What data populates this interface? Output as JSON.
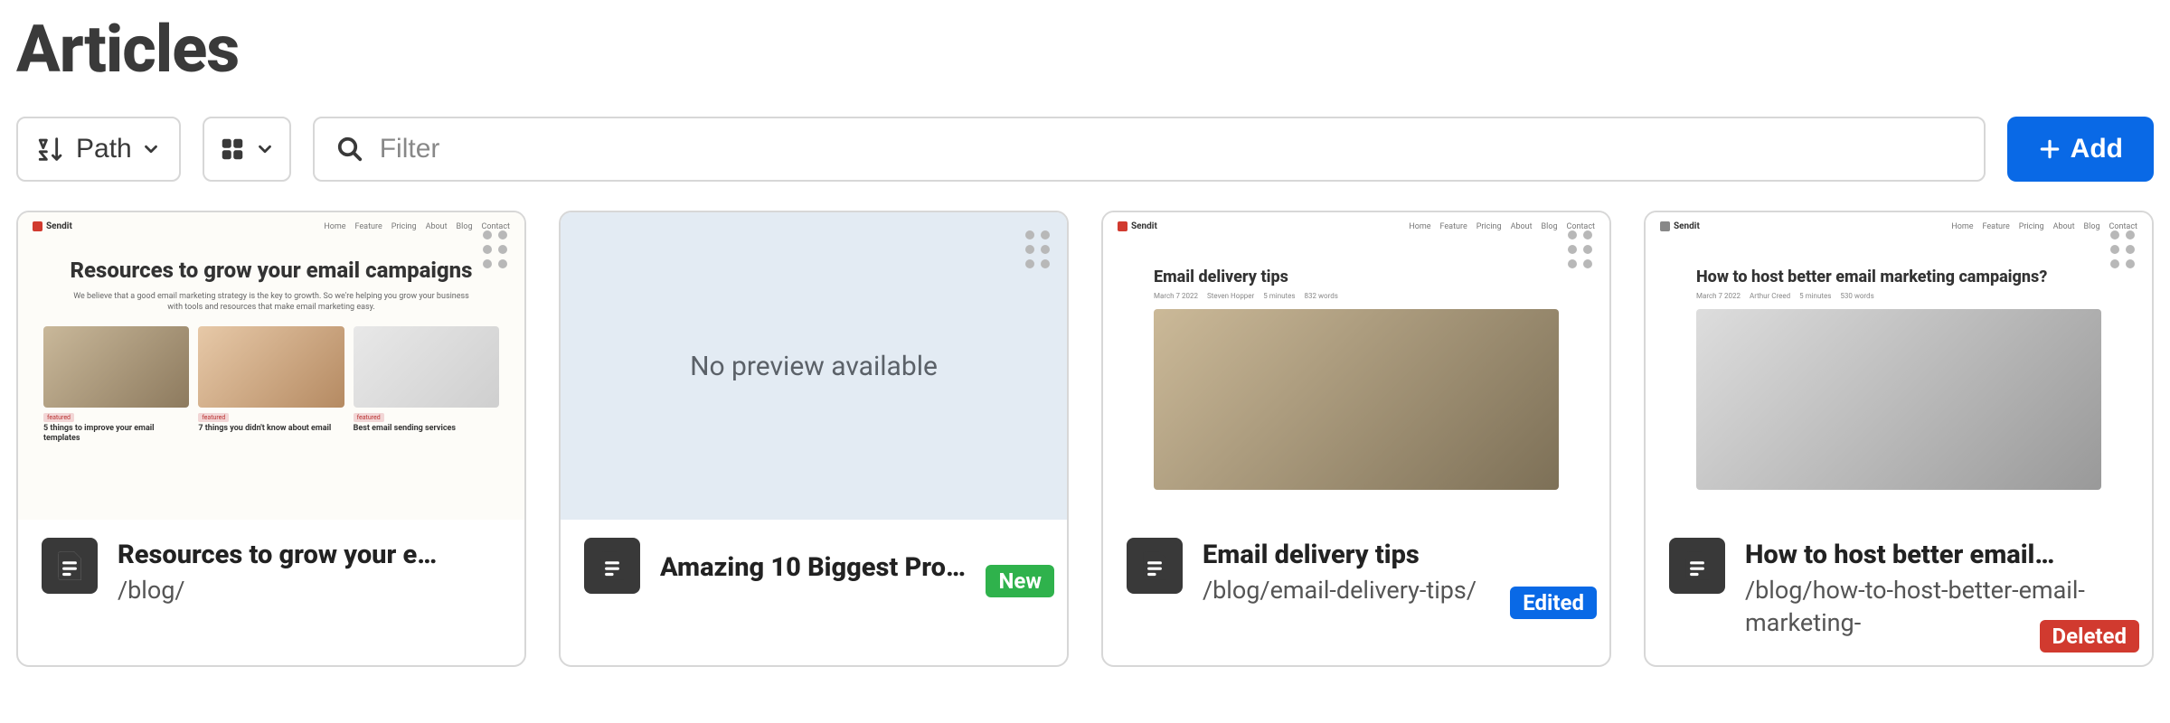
{
  "page": {
    "title": "Articles"
  },
  "toolbar": {
    "sort_label": "Path",
    "filter_placeholder": "Filter",
    "add_label": "Add"
  },
  "no_preview_text": "No preview available",
  "badges": {
    "new": "New",
    "edited": "Edited",
    "deleted": "Deleted"
  },
  "cards": [
    {
      "title": "Resources to grow your e…",
      "path": "/blog/",
      "preview_heading": "Resources to grow your email campaigns",
      "preview_sub": "We believe that a good email marketing strategy is the key to growth. So we're helping you grow your business with tools and resources that make email marketing easy.",
      "cap1": "5 things to improve your email templates",
      "cap2": "7 things you didn't know about email",
      "cap3": "Best email sending services"
    },
    {
      "title": "Amazing 10 Biggest Pro…",
      "path": "",
      "badge": "new"
    },
    {
      "title": "Email delivery tips",
      "path": "/blog/email-delivery-tips/",
      "preview_heading": "Email delivery tips",
      "badge": "edited"
    },
    {
      "title": "How to host better email…",
      "path": "/blog/how-to-host-better-email-marketing-",
      "preview_heading": "How to host better email marketing campaigns?",
      "badge": "deleted"
    }
  ],
  "preview_brand": "Sendit",
  "preview_links": [
    "Home",
    "Feature",
    "Pricing",
    "About",
    "Blog",
    "Contact"
  ]
}
